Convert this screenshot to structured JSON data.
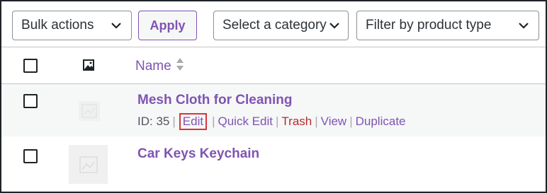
{
  "toolbar": {
    "bulk_actions": "Bulk actions",
    "apply": "Apply",
    "category_placeholder": "Select a category",
    "product_type_placeholder": "Filter by product type"
  },
  "table": {
    "columns": {
      "name": "Name"
    },
    "rows": [
      {
        "name": "Mesh Cloth for Cleaning",
        "id_label": "ID: 35",
        "actions": {
          "edit": "Edit",
          "quick_edit": "Quick Edit",
          "trash": "Trash",
          "view": "View",
          "duplicate": "Duplicate"
        }
      },
      {
        "name": "Car Keys Keychain"
      }
    ]
  },
  "colors": {
    "accent": "#7f54b3",
    "trash": "#b32d2e",
    "highlight": "#d63638"
  },
  "icons": [
    "chevron-down-icon",
    "image-icon",
    "sort-icon",
    "placeholder-image-icon"
  ]
}
